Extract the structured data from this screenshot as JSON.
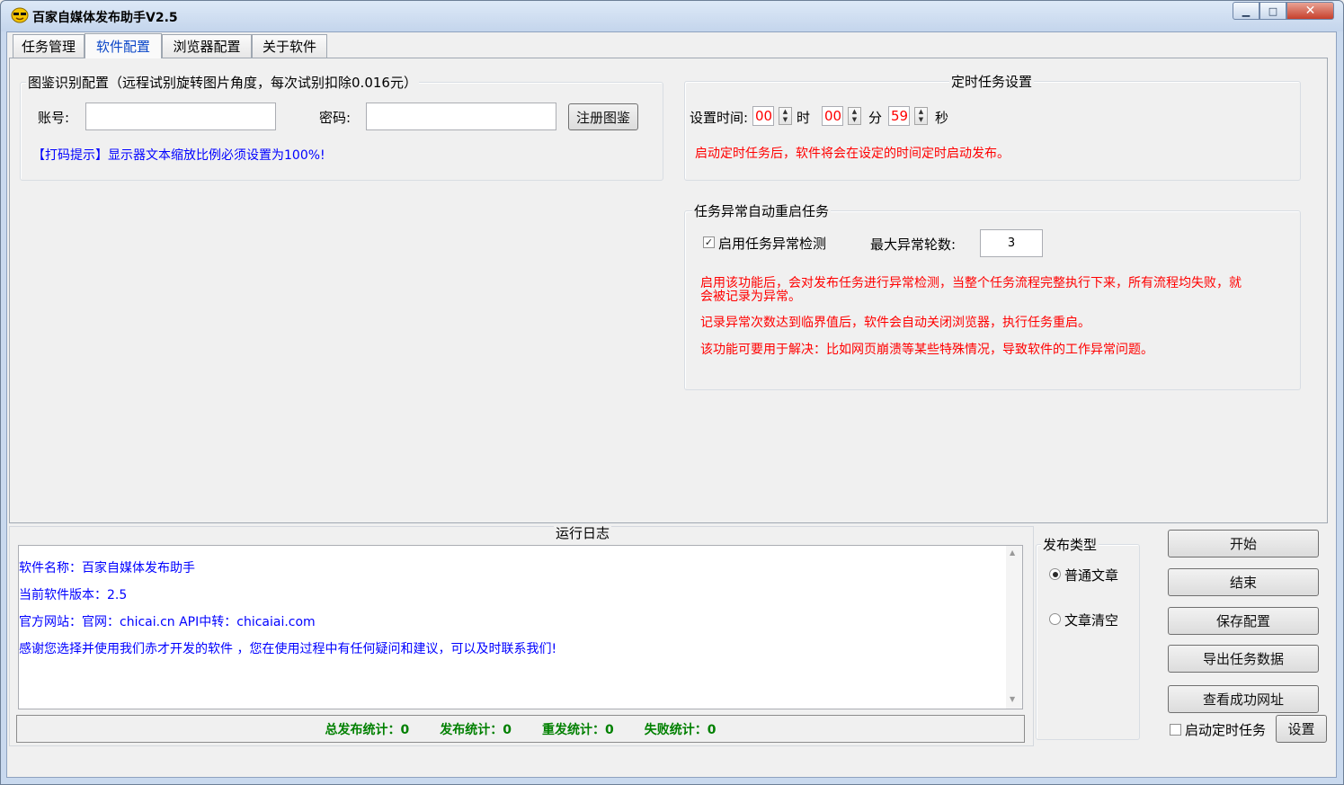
{
  "window": {
    "title": "百家自媒体发布助手V2.5",
    "close_glyph": "✕",
    "max_glyph": "□",
    "min_glyph": "▁"
  },
  "tabs": [
    {
      "label": "任务管理",
      "active": false
    },
    {
      "label": "软件配置",
      "active": true
    },
    {
      "label": "浏览器配置",
      "active": false
    },
    {
      "label": "关于软件",
      "active": false
    }
  ],
  "captcha": {
    "group_title": "图鉴识别配置（远程试别旋转图片角度，每次试别扣除0.016元）",
    "account_label": "账号:",
    "account_value": "",
    "password_label": "密码:",
    "password_value": "",
    "register_button": "注册图鉴",
    "hint": "【打码提示】显示器文本缩放比例必须设置为100%!"
  },
  "timer": {
    "group_title": "定时任务设置",
    "set_time_label": "设置时间:",
    "hour": "00",
    "hour_unit": "时",
    "minute": "00",
    "minute_unit": "分",
    "second": "59",
    "second_unit": "秒",
    "note": "启动定时任务后，软件将会在设定的时间定时启动发布。"
  },
  "restart": {
    "group_title": "任务异常自动重启任务",
    "enable_label": "启用任务异常检测",
    "enable_checked": true,
    "max_label": "最大异常轮数:",
    "max_value": "3",
    "note1_line1": "启用该功能后，会对发布任务进行异常检测，当整个任务流程完整执行下来，所有流程均失败，就",
    "note1_line2": "会被记录为异常。",
    "note2": "记录异常次数达到临界值后，软件会自动关闭浏览器，执行任务重启。",
    "note3": "该功能可要用于解决：比如网页崩溃等某些特殊情况，导致软件的工作异常问题。"
  },
  "log": {
    "title": "运行日志",
    "lines": [
      "软件名称：百家自媒体发布助手",
      "当前软件版本：2.5",
      "官方网站：官网：chicai.cn  API中转：chicaiai.com",
      "感谢您选择并使用我们赤才开发的软件 ，您在使用过程中有任何疑问和建议，可以及时联系我们!"
    ]
  },
  "stats": {
    "total": "总发布统计：0",
    "published": "发布统计：0",
    "republished": "重发统计：0",
    "failed": "失败统计：0"
  },
  "publish_type": {
    "title": "发布类型",
    "options": [
      {
        "label": "普通文章",
        "selected": true
      },
      {
        "label": "文章清空",
        "selected": false
      }
    ]
  },
  "actions": {
    "start": "开始",
    "stop": "结束",
    "save_config": "保存配置",
    "export": "导出任务数据",
    "view_success": "查看成功网址",
    "timer_enable_label": "启动定时任务",
    "timer_enable_checked": false,
    "settings": "设置"
  },
  "colors": {
    "red_text": "#ff0000",
    "blue_text": "#0000ff",
    "green_text": "#008000"
  }
}
